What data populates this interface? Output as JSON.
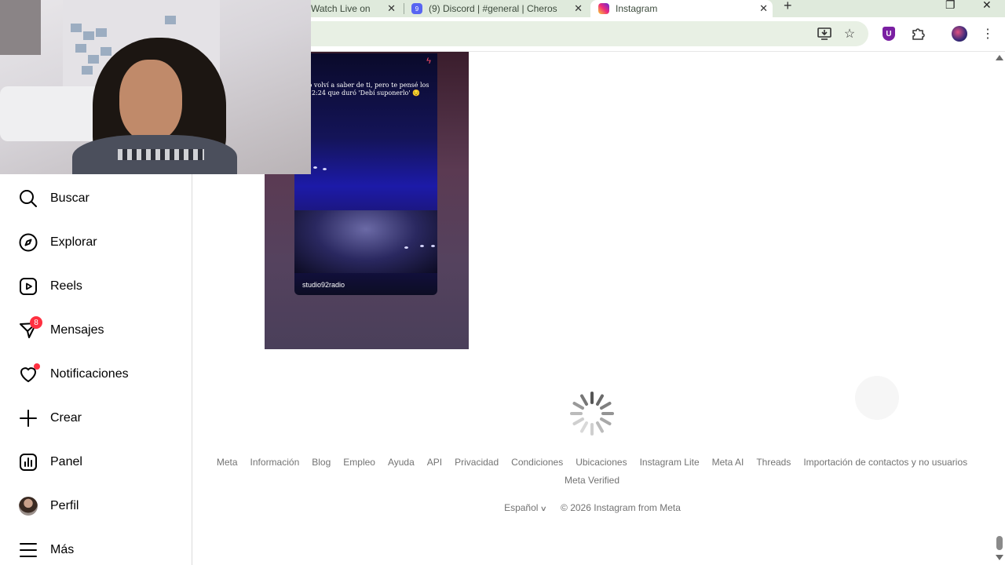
{
  "browser": {
    "tabs": [
      {
        "title": "Watch Live on",
        "active": false
      },
      {
        "title": "(9) Discord | #general | Cheros",
        "active": false
      },
      {
        "title": "Instagram",
        "active": true
      }
    ],
    "new_tab_icon": "plus-icon",
    "colors": {
      "tabstrip": "#dfeadc",
      "omnibox": "#e8f0e4"
    }
  },
  "sidebar": {
    "items": [
      {
        "label": "Buscar",
        "icon": "search-icon"
      },
      {
        "label": "Explorar",
        "icon": "compass-icon"
      },
      {
        "label": "Reels",
        "icon": "reels-icon"
      },
      {
        "label": "Mensajes",
        "icon": "messenger-icon",
        "badge": "8"
      },
      {
        "label": "Notificaciones",
        "icon": "heart-icon",
        "dot": true
      },
      {
        "label": "Crear",
        "icon": "plus-icon"
      },
      {
        "label": "Panel",
        "icon": "dashboard-icon"
      },
      {
        "label": "Perfil",
        "icon": "profile-avatar"
      },
      {
        "label": "Más",
        "icon": "menu-icon"
      }
    ]
  },
  "post": {
    "story_text": "No volví a saber de ti, pero te pensé los 2:24 que duró 'Debí suponerlo' 😔",
    "story_username": "studio92radio"
  },
  "footer": {
    "links": [
      "Meta",
      "Información",
      "Blog",
      "Empleo",
      "Ayuda",
      "API",
      "Privacidad",
      "Condiciones",
      "Ubicaciones",
      "Instagram Lite",
      "Meta AI",
      "Threads",
      "Importación de contactos y no usuarios",
      "Meta Verified"
    ],
    "language": "Español",
    "copyright": "© 2026 Instagram from Meta"
  },
  "colors": {
    "badge": "#ff3040",
    "footer_text": "#737373"
  }
}
